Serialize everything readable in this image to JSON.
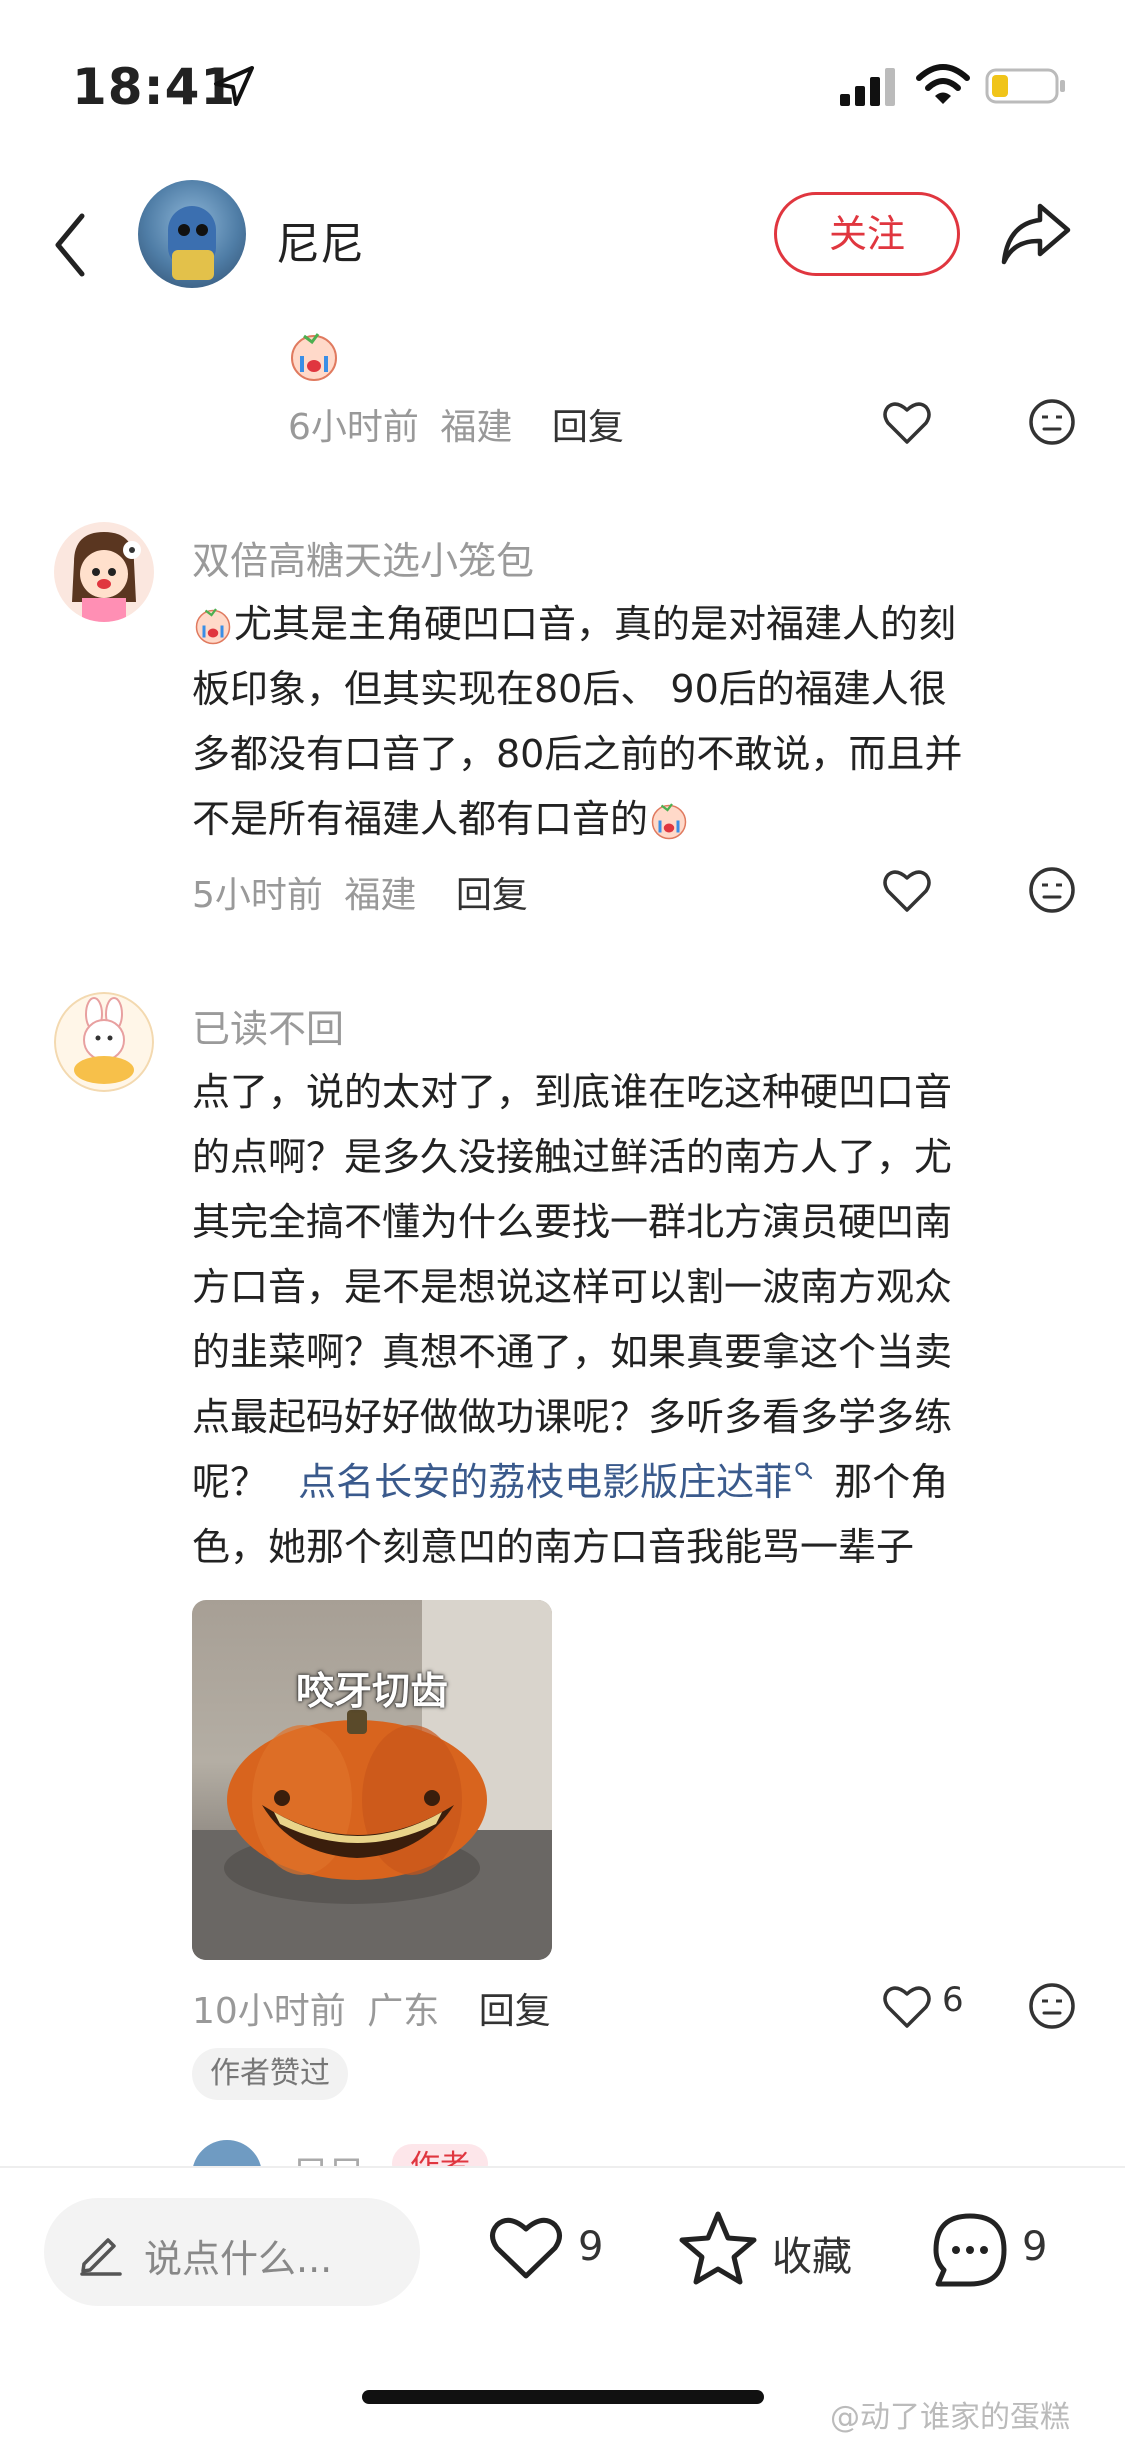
{
  "status_bar": {
    "time": "18:41"
  },
  "header": {
    "name": "尼尼",
    "follow_label": "关注"
  },
  "comment0": {
    "meta_time": "6小时前",
    "meta_loc": "福建",
    "reply": "回复"
  },
  "comment1": {
    "username": "双倍高糖天选小笼包",
    "text": "尤其是主角硬凹口音，真的是对福建人的刻板印象，但其实现在80后、 90后的福建人很多都没有口音了，80后之前的不敢说，而且并不是所有福建人都有口音的",
    "lines": [
      "尤其是主角硬凹口音，真的是对福建人的刻",
      "板印象，但其实现在80后、 90后的福建人很",
      "多都没有口音了，80后之前的不敢说，而且并",
      "不是所有福建人都有口音的"
    ],
    "meta_time": "5小时前",
    "meta_loc": "福建",
    "reply": "回复"
  },
  "comment2": {
    "username": "已读不回",
    "lines": [
      "点了，说的太对了，到底谁在吃这种硬凹口音",
      "的点啊？是多久没接触过鲜活的南方人了，尤",
      "其完全搞不懂为什么要找一群北方演员硬凹南",
      "方口音，是不是想说这样可以割一波南方观众",
      "的韭菜啊？真想不通了，如果真要拿这个当卖",
      "点最起码好好做做功课呢？多听多看多学多练",
      "呢？",
      "那个角",
      "色，她那个刻意凹的南方口音我能骂一辈子"
    ],
    "link": "点名长安的荔枝电影版庄达菲",
    "image_caption": "咬牙切齿",
    "meta_time": "10小时前",
    "meta_loc": "广东",
    "reply": "回复",
    "like_count": "6",
    "author_liked": "作者赞过"
  },
  "peek": {
    "name": "尼尼",
    "badge": "作者"
  },
  "bottom_bar": {
    "input_placeholder": "说点什么...",
    "like_count": "9",
    "collect_label": "收藏",
    "comment_count": "9"
  },
  "watermark": "@动了谁家的蛋糕"
}
